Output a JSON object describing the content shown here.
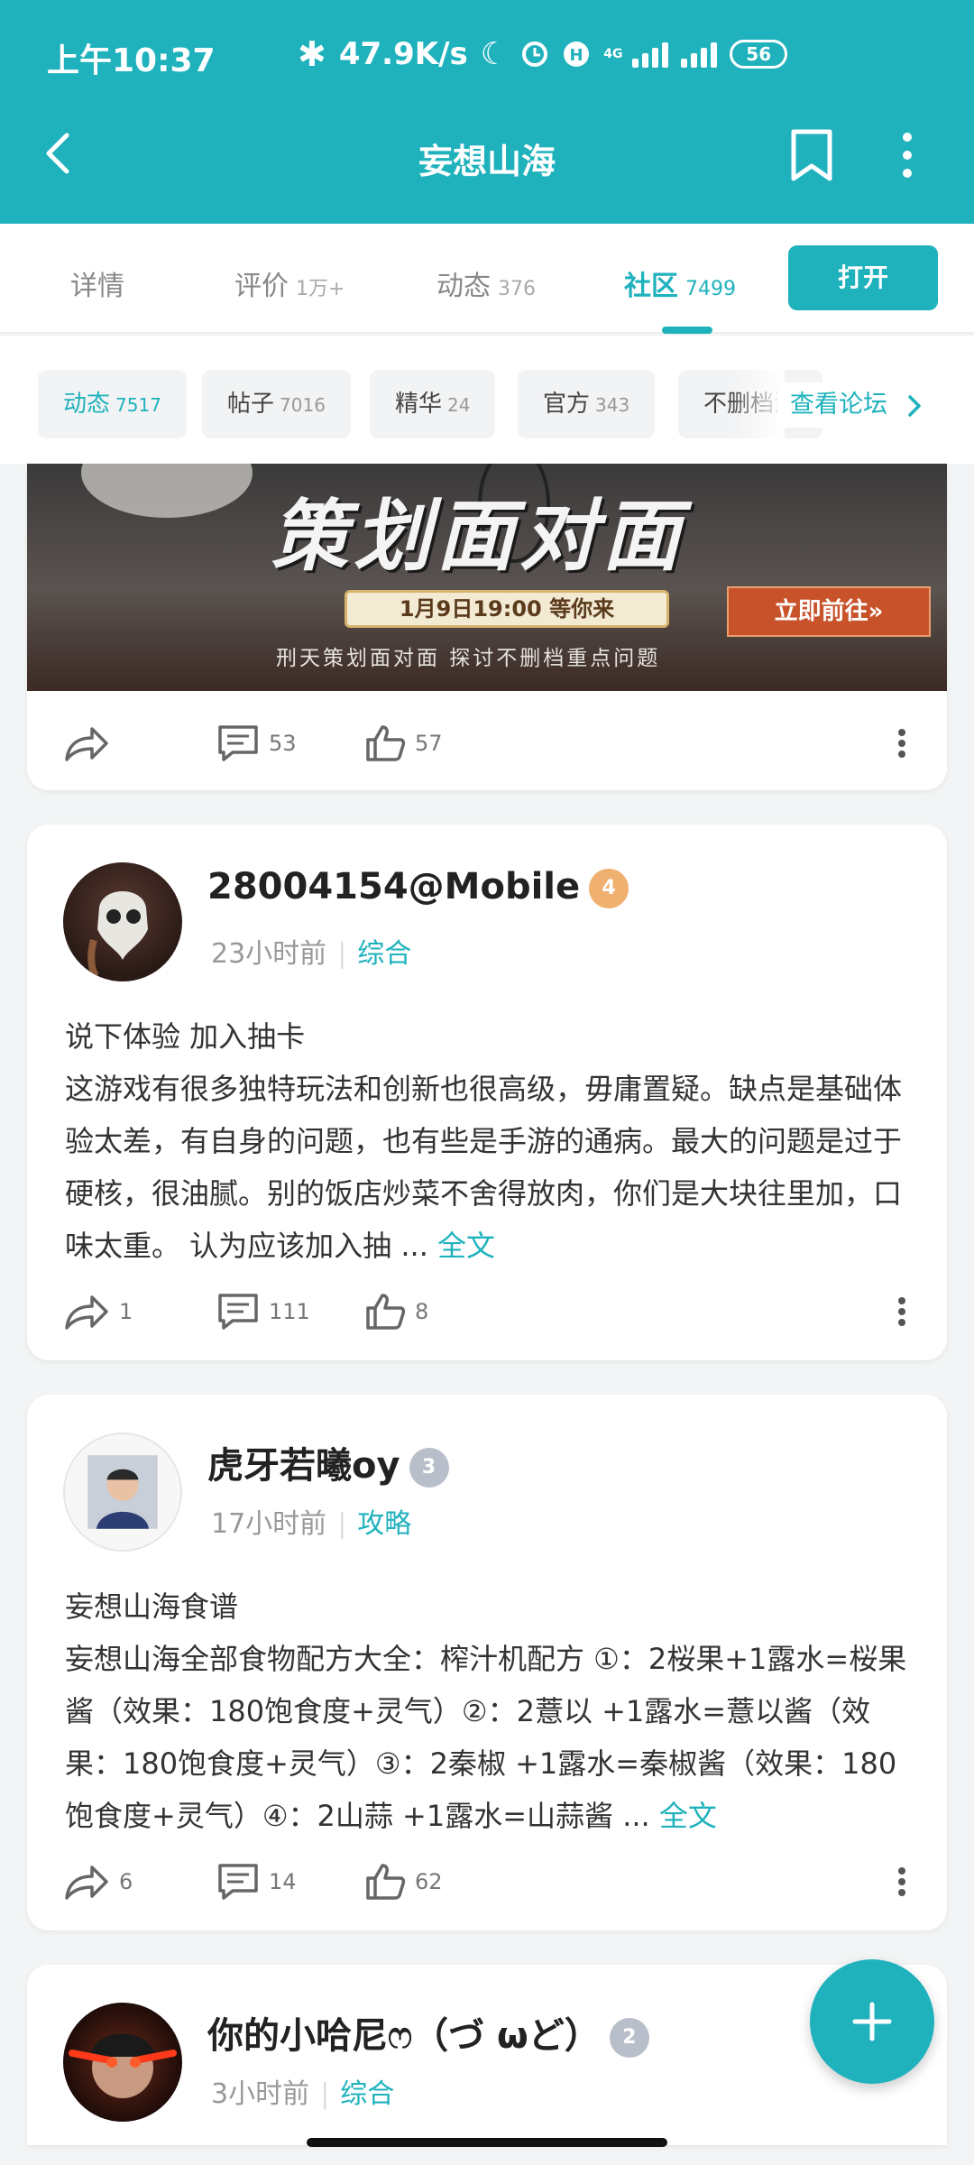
{
  "status_bar": {
    "time": "上午10:37",
    "speed": "47.9K/s",
    "network": "4G",
    "battery": "56"
  },
  "header": {
    "title": "妄想山海"
  },
  "tabs": [
    {
      "label": "详情",
      "count": ""
    },
    {
      "label": "评价",
      "count": "1万+"
    },
    {
      "label": "动态",
      "count": "376"
    },
    {
      "label": "社区",
      "count": "7499"
    }
  ],
  "open_button": "打开",
  "chips": [
    {
      "label": "动态",
      "count": "7517"
    },
    {
      "label": "帖子",
      "count": "7016"
    },
    {
      "label": "精华",
      "count": "24"
    },
    {
      "label": "官方",
      "count": "343"
    },
    {
      "label": "不删档活",
      "count": ""
    }
  ],
  "forum_link": "查看论坛",
  "banner": {
    "title_art": "策划面对面",
    "date": "1月9日19:00 等你来",
    "cta": "立即前往»",
    "caption": "刑天策划面对面  探讨不删档重点问题",
    "shares": "",
    "comments": "53",
    "likes": "57"
  },
  "posts": [
    {
      "author": "28004154@Mobile",
      "level": "4",
      "time": "23小时前",
      "category": "综合",
      "title": "说下体验 加入抽卡",
      "body": "这游戏有很多独特玩法和创新也很高级，毋庸置疑。缺点是基础体验太差，有自身的问题，也有些是手游的通病。最大的问题是过于硬核，很油腻。别的饭店炒菜不舍得放肉，你们是大块往里加，口味太重。     认为应该加入抽 ...",
      "more": "全文",
      "shares": "1",
      "comments": "111",
      "likes": "8"
    },
    {
      "author": "虎牙若曦oy",
      "level": "3",
      "time": "17小时前",
      "category": "攻略",
      "title": "妄想山海食谱",
      "body": "妄想山海全部食物配方大全：榨汁机配方 ①：2桜果+1露水=桜果酱（效果：180饱食度+灵气）②：2薏以 +1露水=薏以酱（效果：180饱食度+灵气）③：2秦椒 +1露水=秦椒酱（效果：180饱食度+灵气）④：2山蒜 +1露水=山蒜酱 ...",
      "more": "全文",
      "shares": "6",
      "comments": "14",
      "likes": "62"
    },
    {
      "author": "你的小哈尼ෆ（づ ωど）",
      "level": "2",
      "time": "3小时前",
      "category": "综合"
    }
  ]
}
